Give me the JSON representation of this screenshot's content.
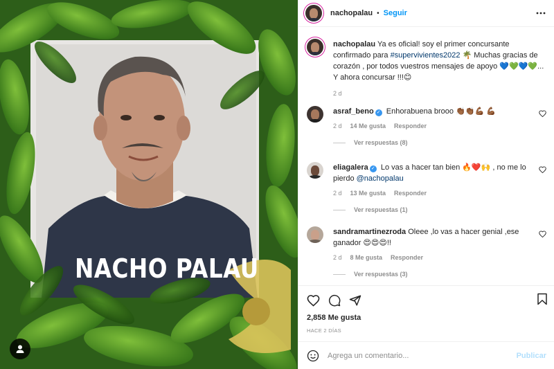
{
  "photo": {
    "title_text": "NACHO PALAU",
    "user_tag_icon": "user-icon"
  },
  "header": {
    "username": "nachopalau",
    "separator": "•",
    "follow_label": "Seguir",
    "more_icon": "ellipsis-icon"
  },
  "caption": {
    "username": "nachopalau",
    "text_before": "Ya es oficial! soy el primer concursante confirmado para",
    "hashtag": "#supervivientes2022",
    "text_after": "🌴 Muchas gracias de corazón , por todos vuestros mensajes de apoyo 💙💚💙💚... Y ahora concursar !!!😊",
    "time": "2 d"
  },
  "comments": [
    {
      "username": "asraf_beno",
      "verified": true,
      "text": "Enhorabuena brooo 👏🏾👏🏾💪🏾 💪🏾",
      "time": "2 d",
      "likes": "14 Me gusta",
      "reply_label": "Responder",
      "view_replies": "Ver respuestas (8)"
    },
    {
      "username": "eliagalera",
      "verified": true,
      "text": "Lo vas a hacer tan bien 🔥❤️🙌 , no me lo pierdo",
      "mention": "@nachopalau",
      "time": "2 d",
      "likes": "13 Me gusta",
      "reply_label": "Responder",
      "view_replies": "Ver respuestas (1)"
    },
    {
      "username": "sandramartinezroda",
      "verified": false,
      "text": "Oleee ,lo vas a hacer genial ,ese ganador 😍😍😍!!",
      "time": "2 d",
      "likes": "8 Me gusta",
      "reply_label": "Responder",
      "view_replies": "Ver respuestas (3)"
    }
  ],
  "actions": {
    "likes": "2,858 Me gusta",
    "timestamp": "HACE 2 DÍAS"
  },
  "add_comment": {
    "placeholder": "Agrega un comentario...",
    "publish_label": "Publicar"
  },
  "colors": {
    "accent": "#0095f6",
    "publish_disabled": "#b2dffc",
    "muted": "#8e8e8e",
    "verified": "#3897f0"
  }
}
